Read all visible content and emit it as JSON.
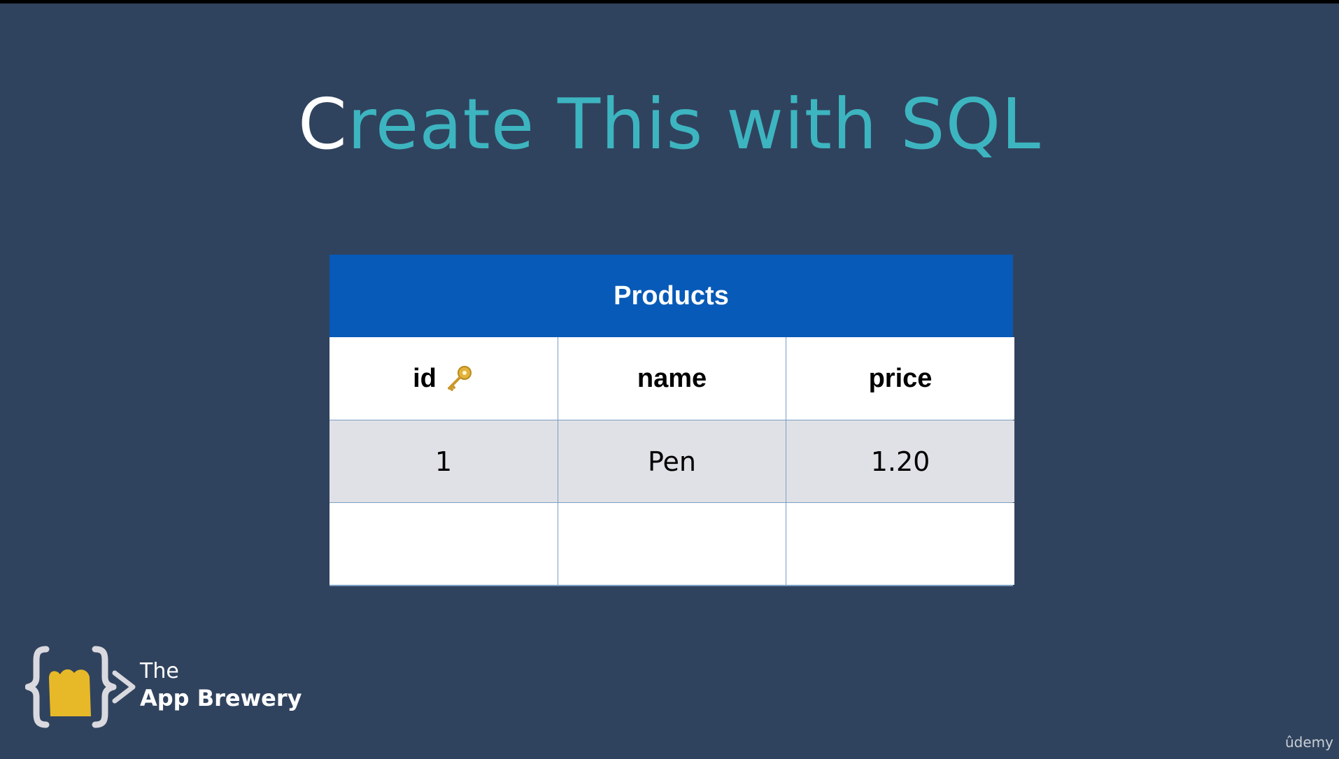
{
  "slide": {
    "title_first": "C",
    "title_rest": "reate This with SQL"
  },
  "table": {
    "caption": "Products",
    "headers": [
      "id",
      "name",
      "price"
    ],
    "header_icons": [
      "key-icon",
      "",
      ""
    ],
    "rows": [
      [
        "1",
        "Pen",
        "1.20"
      ],
      [
        "",
        "",
        ""
      ]
    ]
  },
  "brand": {
    "line1": "The",
    "line2": "App Brewery"
  },
  "watermark": "ûdemy",
  "colors": {
    "background": "#30435e",
    "title": "#3db5c0",
    "table_header": "#075ab7",
    "data_row": "#e0e1e6",
    "logo_yellow": "#e7b928"
  }
}
